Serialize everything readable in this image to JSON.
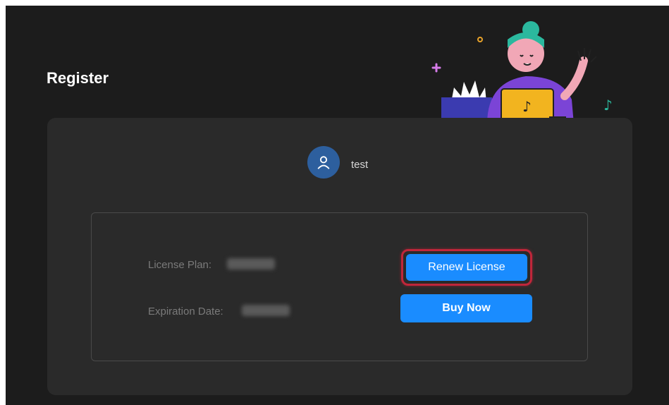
{
  "page": {
    "title": "Register"
  },
  "user": {
    "name": "test",
    "avatar_icon": "user-icon"
  },
  "license": {
    "plan_label": "License Plan:",
    "plan_value": "",
    "expiration_label": "Expiration Date:",
    "expiration_value": ""
  },
  "actions": {
    "renew_label": "Renew License",
    "buy_label": "Buy Now"
  },
  "colors": {
    "background": "#1c1c1c",
    "card": "#2a2a2a",
    "accent": "#1a8cff",
    "highlight": "#c0263a"
  }
}
